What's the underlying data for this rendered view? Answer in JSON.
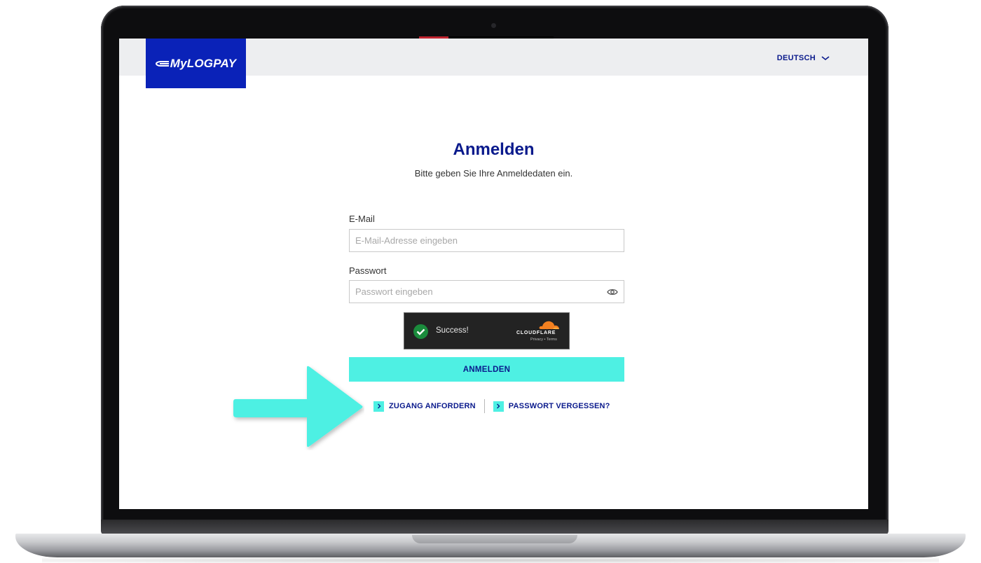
{
  "brand": {
    "name": "MyLOGPAY",
    "accent": "#0a22b8",
    "button_color": "#4ef0e3",
    "text_blue": "#0a1a8c"
  },
  "header": {
    "language": "DEUTSCH",
    "language_icon": "chevron-down-icon"
  },
  "login": {
    "title": "Anmelden",
    "subtitle": "Bitte geben Sie Ihre Anmeldedaten ein.",
    "email_label": "E-Mail",
    "email_placeholder": "E-Mail-Adresse eingeben",
    "email_value": "",
    "password_label": "Passwort",
    "password_placeholder": "Passwort eingeben",
    "password_value": "",
    "password_icon": "eye-icon",
    "submit_label": "ANMELDEN"
  },
  "captcha": {
    "status": "Success!",
    "provider": "CLOUDFLARE",
    "links": "Privacy • Terms",
    "status_color": "#1a8b3c"
  },
  "links": [
    {
      "label": "ZUGANG ANFORDERN",
      "icon": "chevron-right-icon"
    },
    {
      "label": "PASSWORT VERGESSEN?",
      "icon": "chevron-right-icon"
    }
  ],
  "annotation": {
    "icon": "pointer-arrow-icon",
    "color": "#4ef0e3"
  }
}
